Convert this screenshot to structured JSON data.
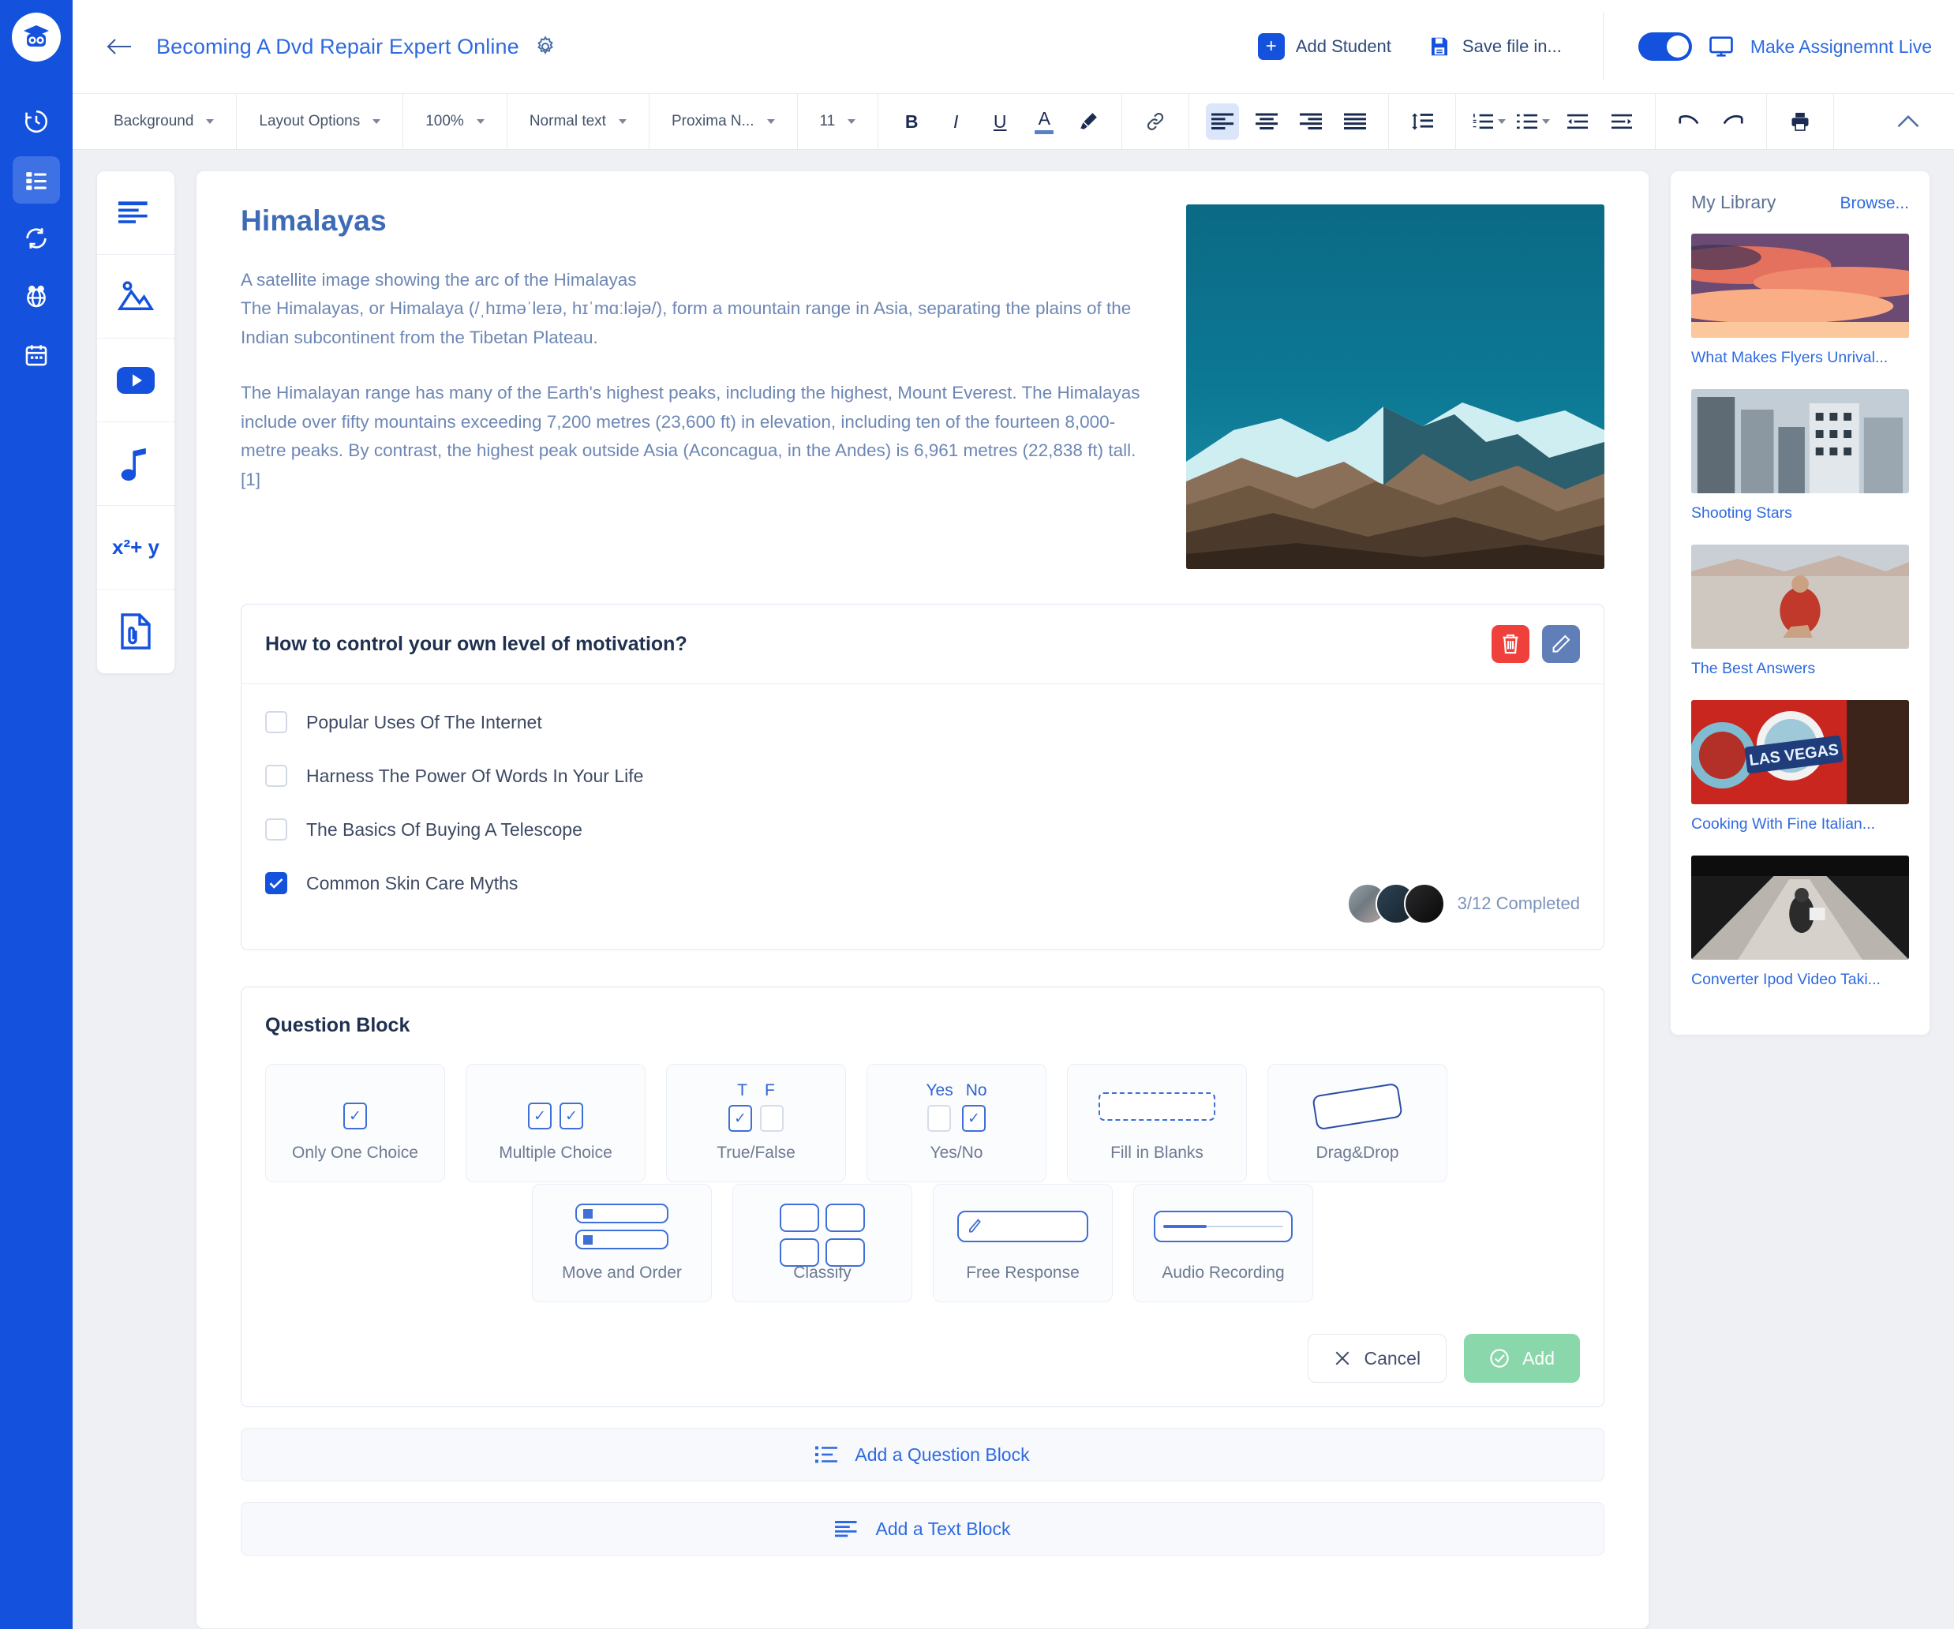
{
  "rail": {
    "logo_icon": "graduation-owl-logo",
    "items": [
      {
        "icon": "history-clock-icon",
        "active": false
      },
      {
        "icon": "list-tasks-icon",
        "active": true
      },
      {
        "icon": "sync-refresh-icon",
        "active": false
      },
      {
        "icon": "globe-network-icon",
        "active": false
      },
      {
        "icon": "calendar-icon",
        "active": false
      }
    ]
  },
  "header": {
    "back_icon": "back-arrow-icon",
    "title": "Becoming A Dvd Repair Expert Online",
    "gear_icon": "gear-icon",
    "add_student_label": "Add Student",
    "add_student_icon": "plus-icon",
    "save_file_label": "Save file in...",
    "save_file_icon": "floppy-save-icon",
    "toggle_on": true,
    "make_live_label": "Make Assignemnt Live",
    "make_live_icon": "monitor-icon"
  },
  "toolbar": {
    "background_label": "Background",
    "layout_options_label": "Layout Options",
    "zoom_label": "100%",
    "text_style_label": "Normal text",
    "font_label": "Proxima N...",
    "font_size_label": "11",
    "bold_label": "B",
    "italic_label": "I",
    "underline_label": "U",
    "text_color_label": "A",
    "highlighter_icon": "highlighter-pen-icon",
    "link_icon": "link-icon",
    "align_left_icon": "align-left-icon",
    "align_center_icon": "align-center-icon",
    "align_right_icon": "align-right-icon",
    "align_justify_icon": "align-justify-icon",
    "line_spacing_icon": "line-spacing-icon",
    "numbered_list_icon": "numbered-list-icon",
    "bulleted_list_icon": "bulleted-list-icon",
    "outdent_icon": "outdent-icon",
    "indent_icon": "indent-icon",
    "undo_icon": "undo-icon",
    "redo_icon": "redo-icon",
    "print_icon": "print-icon",
    "collapse_icon": "chevron-up-icon"
  },
  "tool_strip": [
    {
      "icon": "text-block-icon"
    },
    {
      "icon": "image-icon"
    },
    {
      "icon": "youtube-video-icon"
    },
    {
      "icon": "music-note-icon"
    },
    {
      "icon": "equation-icon",
      "label": "x²+ y"
    },
    {
      "icon": "attachment-file-icon"
    }
  ],
  "article": {
    "title": "Himalayas",
    "paragraph1_line1": "A satellite image showing the arc of the Himalayas",
    "paragraph1_line2": "The Himalayas, or Himalaya (/ˌhɪməˈleɪə, hɪˈmɑːləjə/), form a mountain range in Asia, separating the plains of the Indian subcontinent from the Tibetan Plateau.",
    "paragraph2": "The Himalayan range has many of the Earth's highest peaks, including the highest, Mount Everest. The Himalayas include over fifty mountains exceeding 7,200 metres (23,600 ft) in elevation, including ten of the fourteen 8,000-metre peaks. By contrast, the highest peak outside Asia (Aconcagua, in the Andes) is 6,961 metres (22,838 ft) tall.[1]",
    "hero_image_alt": "himalayas-mountain-photo"
  },
  "question_card": {
    "title": "How to control your own level of motivation?",
    "delete_icon": "trash-icon",
    "edit_icon": "pencil-icon",
    "options": [
      {
        "label": "Popular Uses Of The Internet",
        "checked": false
      },
      {
        "label": "Harness The Power Of Words In Your Life",
        "checked": false
      },
      {
        "label": "The Basics Of Buying A Telescope",
        "checked": false
      },
      {
        "label": "Common Skin Care Myths",
        "checked": true
      }
    ],
    "progress_text": "3/12 Completed",
    "avatar_count": 3
  },
  "question_block": {
    "title": "Question Block",
    "types_row1": [
      {
        "label": "Only One Choice",
        "icon": "single-checkbox-icon"
      },
      {
        "label": "Multiple Choice",
        "icon": "double-checkbox-icon"
      },
      {
        "label": "True/False",
        "icon": "true-false-icon",
        "t_label": "T",
        "f_label": "F"
      },
      {
        "label": "Yes/No",
        "icon": "yes-no-icon",
        "yes_label": "Yes",
        "no_label": "No"
      },
      {
        "label": "Fill in Blanks",
        "icon": "dashed-blank-icon"
      },
      {
        "label": "Drag&Drop",
        "icon": "tilted-card-icon"
      }
    ],
    "types_row2": [
      {
        "label": "Move and Order",
        "icon": "reorder-rows-icon"
      },
      {
        "label": "Classify",
        "icon": "four-boxes-icon"
      },
      {
        "label": "Free Response",
        "icon": "pencil-input-icon"
      },
      {
        "label": "Audio Recording",
        "icon": "audio-waveform-icon"
      }
    ],
    "cancel_label": "Cancel",
    "cancel_icon": "close-x-icon",
    "add_label": "Add",
    "add_icon": "check-circle-icon"
  },
  "add_rows": [
    {
      "label": "Add a Question Block",
      "icon": "question-list-icon"
    },
    {
      "label": "Add a Text Block",
      "icon": "text-lines-icon"
    }
  ],
  "library": {
    "title": "My Library",
    "browse_label": "Browse...",
    "items": [
      {
        "label": "What Makes Flyers Unrival...",
        "thumb": "sunset-clouds-photo"
      },
      {
        "label": "Shooting Stars",
        "thumb": "city-buildings-photo"
      },
      {
        "label": "The Best Answers",
        "thumb": "woman-on-beach-photo"
      },
      {
        "label": "Cooking With Fine Italian...",
        "thumb": "las-vegas-sign-photo"
      },
      {
        "label": "Converter Ipod Video Taki...",
        "thumb": "road-walking-photo"
      }
    ]
  },
  "colors": {
    "brand_blue": "#1452dd",
    "link_blue": "#2f6ae0",
    "danger_red": "#f0403c",
    "edit_blue": "#607fb8",
    "add_green": "#8ad7ab",
    "body_text": "#6d87b4"
  }
}
